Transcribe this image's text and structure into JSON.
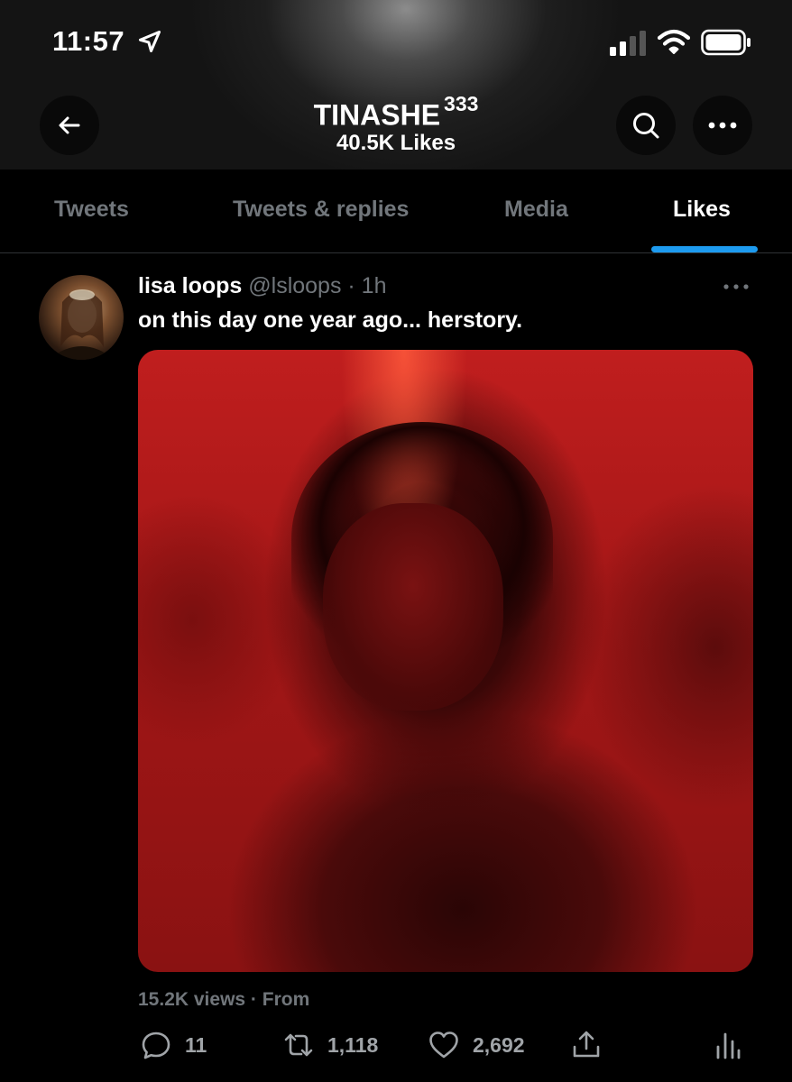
{
  "status_bar": {
    "time": "11:57",
    "icons": [
      "location-arrow-icon",
      "cellular-signal-icon",
      "wifi-icon",
      "battery-icon"
    ]
  },
  "header": {
    "name": "TINASHE",
    "name_suffix": "333",
    "subtitle": "40.5K Likes"
  },
  "tabs": [
    {
      "label": "Tweets",
      "active": false
    },
    {
      "label": "Tweets & replies",
      "active": false
    },
    {
      "label": "Media",
      "active": false
    },
    {
      "label": "Likes",
      "active": true
    }
  ],
  "tweet": {
    "display_name": "lisa loops",
    "meta": "@lsloops · 1h",
    "text": "on this day one year ago... herstory.",
    "views_line": "15.2K views · From",
    "actions": {
      "replies": "11",
      "retweets": "1,118",
      "likes": "2,692"
    }
  },
  "colors": {
    "accent": "#1d9bf0",
    "muted_text": "#71767b",
    "background": "#000000",
    "media_red": "#b01a1a"
  }
}
